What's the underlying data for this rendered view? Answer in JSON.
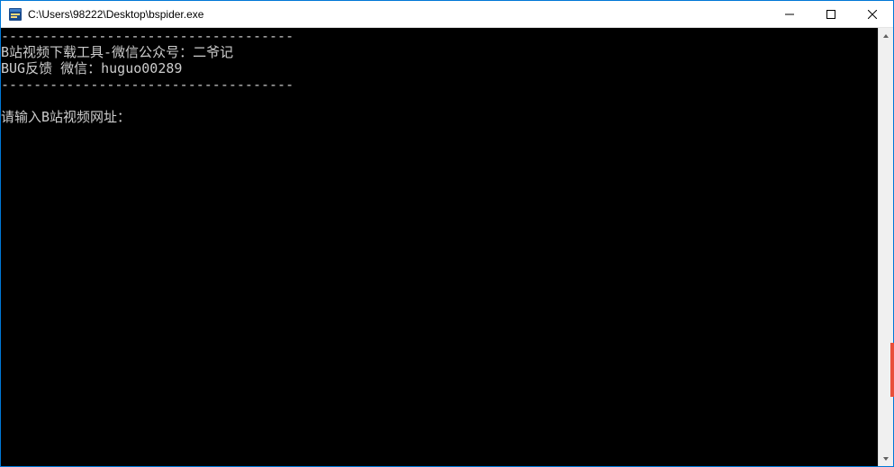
{
  "window": {
    "title": "C:\\Users\\98222\\Desktop\\bspider.exe"
  },
  "console": {
    "divider1": "------------------------------------",
    "line1": "B站视频下载工具-微信公众号：二爷记",
    "line2": "BUG反馈 微信：huguo00289",
    "divider2": "------------------------------------",
    "prompt": "请输入B站视频网址："
  }
}
